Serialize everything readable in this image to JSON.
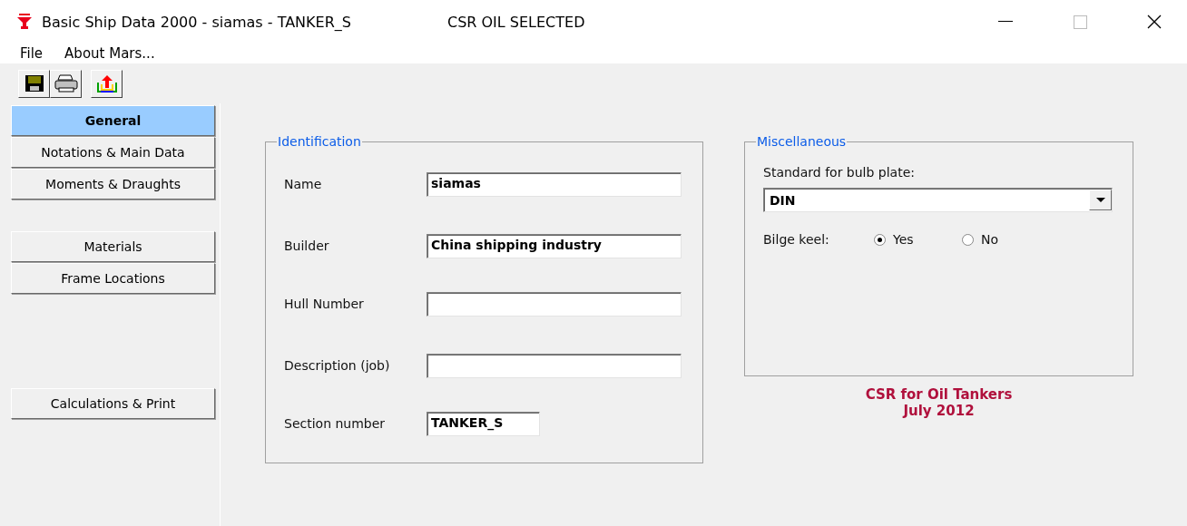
{
  "window": {
    "title": "Basic Ship Data 2000 - siamas - TANKER_S",
    "subtitle": "CSR OIL SELECTED"
  },
  "menu": [
    {
      "label": "File"
    },
    {
      "label": "About Mars..."
    }
  ],
  "toolbar": [
    {
      "kind": "save"
    },
    {
      "kind": "print"
    },
    {
      "kind": "export"
    }
  ],
  "sidebar": {
    "groups": [
      [
        {
          "label": "General",
          "selected": true
        },
        {
          "label": "Notations & Main Data",
          "selected": false
        },
        {
          "label": "Moments & Draughts",
          "selected": false
        }
      ],
      [
        {
          "label": "Materials",
          "selected": false
        },
        {
          "label": "Frame Locations",
          "selected": false
        }
      ],
      [
        {
          "label": "Calculations & Print",
          "selected": false
        }
      ]
    ]
  },
  "identification": {
    "title": "Identification",
    "fields": [
      {
        "label": "Name",
        "value": "siamas",
        "kind": "wide"
      },
      {
        "label": "Builder",
        "value": "China shipping industry",
        "kind": "wide"
      },
      {
        "label": "Hull Number",
        "kind": "wide"
      },
      {
        "label": "Description (job)",
        "kind": "wide"
      },
      {
        "label": "Section number",
        "value": "TANKER_S",
        "kind": "short"
      }
    ]
  },
  "miscellaneous": {
    "title": "Miscellaneous",
    "bulb_label": "Standard for bulb plate:",
    "bulb_value": "DIN",
    "bilge_label": "Bilge keel:",
    "options": [
      {
        "label": "Yes",
        "selected": true
      },
      {
        "label": "No",
        "selected": false
      }
    ]
  },
  "rule_note": [
    "CSR for Oil Tankers",
    "July 2012"
  ]
}
